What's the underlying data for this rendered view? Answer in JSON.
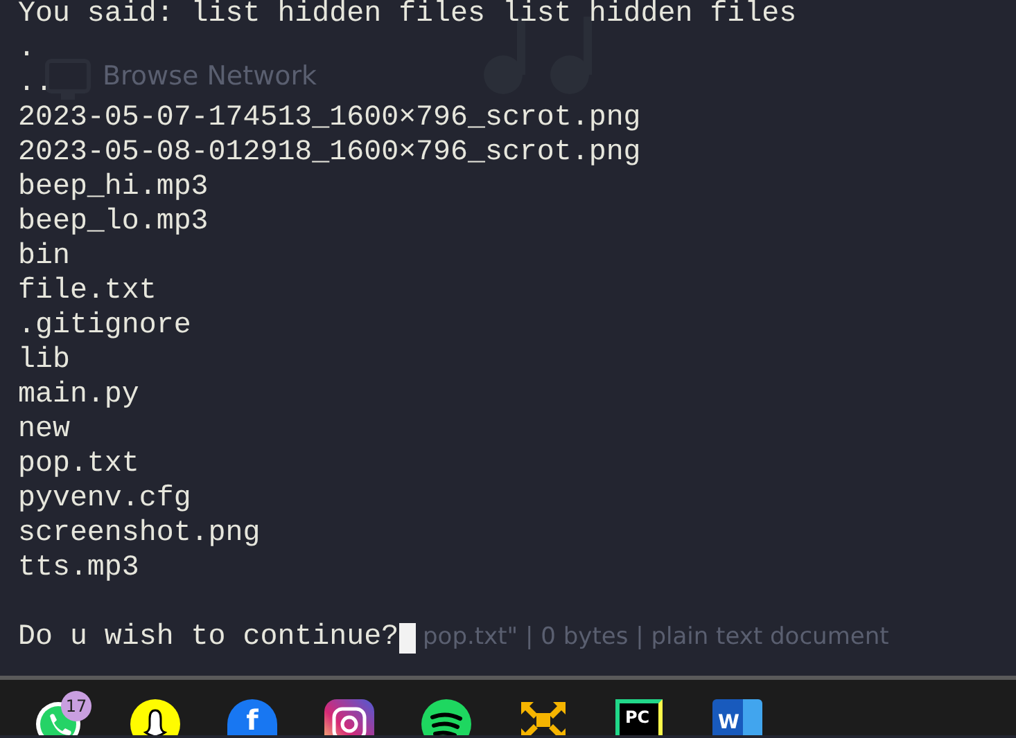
{
  "background_window": {
    "network_label": "Browse Network",
    "status_text": "pop.txt\" | 0 bytes | plain text document"
  },
  "terminal": {
    "lines": [
      "You said: list hidden files list hidden files",
      ".",
      "..",
      "2023-05-07-174513_1600×796_scrot.png",
      "2023-05-08-012918_1600×796_scrot.png",
      "beep_hi.mp3",
      "beep_lo.mp3",
      "bin",
      "file.txt",
      ".gitignore",
      "lib",
      "main.py",
      "new",
      "pop.txt",
      "pyvenv.cfg",
      "screenshot.png",
      "tts.mp3"
    ],
    "prompt": "Do u wish to continue?",
    "cursor_visible": true
  },
  "taskbar": {
    "apps": [
      {
        "kind": "chat-bubble",
        "badge": "17"
      },
      {
        "kind": "ghost"
      },
      {
        "kind": "letter-circle",
        "glyph": "f"
      },
      {
        "kind": "camera-square"
      },
      {
        "kind": "bars-circle"
      },
      {
        "kind": "arrows"
      },
      {
        "kind": "letter-square",
        "glyph": "PC"
      },
      {
        "kind": "document-letter",
        "glyph": "W"
      }
    ]
  }
}
